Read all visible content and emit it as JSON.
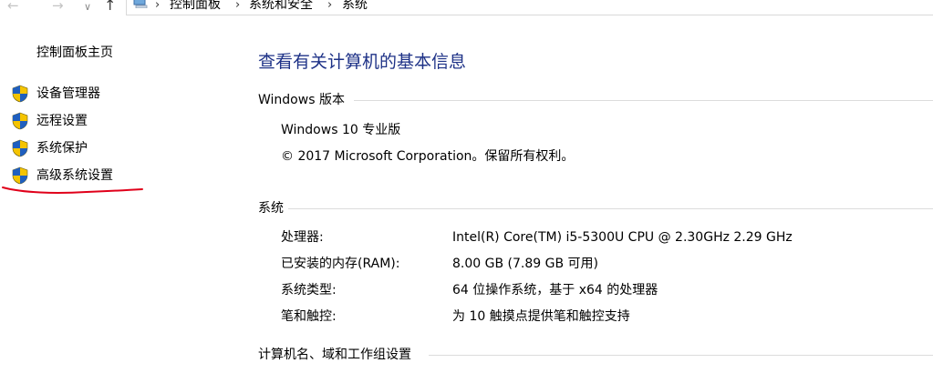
{
  "nav": {
    "back_icon": "arrow-left-icon",
    "forward_icon": "arrow-right-icon",
    "recent_icon": "chevron-down-icon",
    "up_icon": "arrow-up-icon",
    "breadcrumbs": [
      "控制面板",
      "系统和安全",
      "系统"
    ]
  },
  "sidebar": {
    "home_label": "控制面板主页",
    "items": [
      {
        "label": "设备管理器",
        "icon": "uac-shield-icon"
      },
      {
        "label": "远程设置",
        "icon": "uac-shield-icon"
      },
      {
        "label": "系统保护",
        "icon": "uac-shield-icon"
      },
      {
        "label": "高级系统设置",
        "icon": "uac-shield-icon"
      }
    ],
    "annotation_color": "#e0001a"
  },
  "main": {
    "title": "查看有关计算机的基本信息",
    "title_color": "#1e3287",
    "windows_section": {
      "heading": "Windows 版本",
      "edition": "Windows 10 专业版",
      "copyright": "© 2017 Microsoft Corporation。保留所有权利。"
    },
    "system_section": {
      "heading": "系统",
      "rows": [
        {
          "label": "处理器:",
          "value": "Intel(R) Core(TM) i5-5300U CPU @ 2.30GHz   2.29 GHz"
        },
        {
          "label": "已安装的内存(RAM):",
          "value": "8.00 GB (7.89 GB 可用)"
        },
        {
          "label": "系统类型:",
          "value": "64 位操作系统，基于 x64 的处理器"
        },
        {
          "label": "笔和触控:",
          "value": "为 10 触摸点提供笔和触控支持"
        }
      ]
    },
    "computer_section": {
      "heading": "计算机名、域和工作组设置"
    }
  }
}
